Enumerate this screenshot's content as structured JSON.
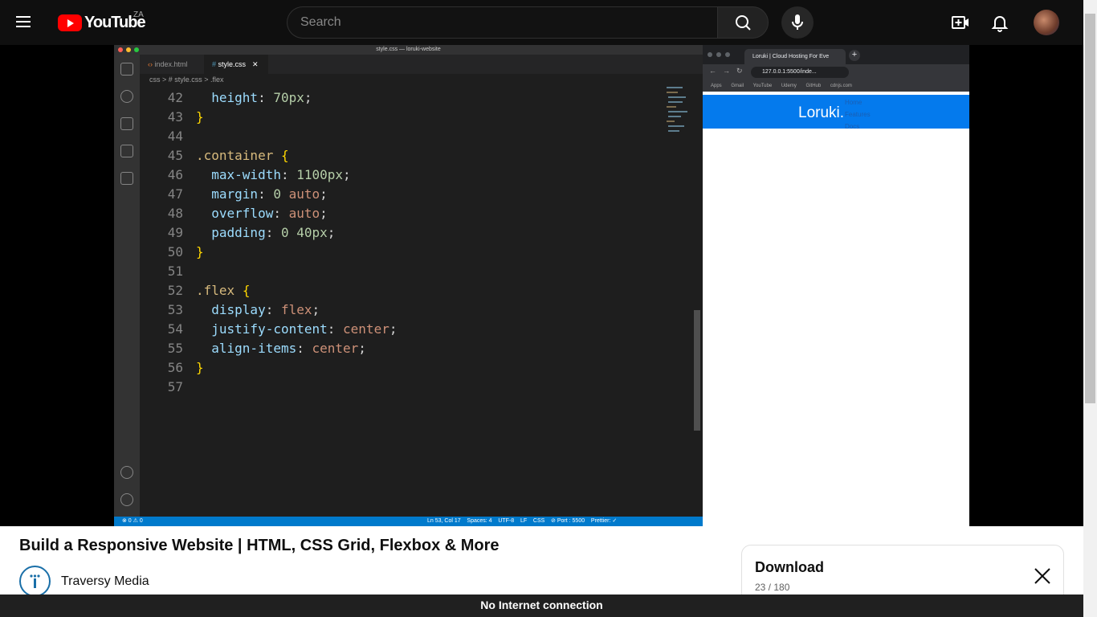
{
  "header": {
    "logo_text": "YouTube",
    "country": "ZA",
    "search_placeholder": "Search"
  },
  "vscode": {
    "window_title": "style.css — loruki-website",
    "tabs": [
      {
        "label": "index.html",
        "active": false
      },
      {
        "label": "style.css",
        "active": true
      }
    ],
    "breadcrumb": "css  >  # style.css  >  .flex",
    "code": [
      {
        "ln": "42",
        "parts": [
          [
            "prop",
            "  height"
          ],
          [
            "punc",
            ": "
          ],
          [
            "num",
            "70px"
          ],
          [
            "punc",
            ";"
          ]
        ]
      },
      {
        "ln": "43",
        "parts": [
          [
            "brace",
            "}"
          ]
        ]
      },
      {
        "ln": "44",
        "parts": []
      },
      {
        "ln": "45",
        "parts": [
          [
            "sel",
            ".container"
          ],
          [
            "punc",
            " "
          ],
          [
            "brace",
            "{"
          ]
        ]
      },
      {
        "ln": "46",
        "parts": [
          [
            "prop",
            "  max-width"
          ],
          [
            "punc",
            ": "
          ],
          [
            "num",
            "1100px"
          ],
          [
            "punc",
            ";"
          ]
        ]
      },
      {
        "ln": "47",
        "parts": [
          [
            "prop",
            "  margin"
          ],
          [
            "punc",
            ": "
          ],
          [
            "num",
            "0"
          ],
          [
            "punc",
            " "
          ],
          [
            "val",
            "auto"
          ],
          [
            "punc",
            ";"
          ]
        ]
      },
      {
        "ln": "48",
        "parts": [
          [
            "prop",
            "  overflow"
          ],
          [
            "punc",
            ": "
          ],
          [
            "val",
            "auto"
          ],
          [
            "punc",
            ";"
          ]
        ]
      },
      {
        "ln": "49",
        "parts": [
          [
            "prop",
            "  padding"
          ],
          [
            "punc",
            ": "
          ],
          [
            "num",
            "0"
          ],
          [
            "punc",
            " "
          ],
          [
            "num",
            "40px"
          ],
          [
            "punc",
            ";"
          ]
        ]
      },
      {
        "ln": "50",
        "parts": [
          [
            "brace",
            "}"
          ]
        ]
      },
      {
        "ln": "51",
        "parts": []
      },
      {
        "ln": "52",
        "parts": [
          [
            "sel",
            ".flex"
          ],
          [
            "punc",
            " "
          ],
          [
            "brace",
            "{"
          ]
        ]
      },
      {
        "ln": "53",
        "parts": [
          [
            "prop",
            "  display"
          ],
          [
            "punc",
            ": "
          ],
          [
            "val",
            "flex"
          ],
          [
            "punc",
            ";"
          ]
        ]
      },
      {
        "ln": "54",
        "parts": [
          [
            "prop",
            "  justify-content"
          ],
          [
            "punc",
            ": "
          ],
          [
            "val",
            "center"
          ],
          [
            "punc",
            ";"
          ]
        ]
      },
      {
        "ln": "55",
        "parts": [
          [
            "prop",
            "  align-items"
          ],
          [
            "punc",
            ": "
          ],
          [
            "val",
            "center"
          ],
          [
            "punc",
            ";"
          ]
        ]
      },
      {
        "ln": "56",
        "parts": [
          [
            "brace",
            "}"
          ]
        ]
      },
      {
        "ln": "57",
        "parts": []
      }
    ],
    "status_left": "⊗ 0 ⚠ 0",
    "status_right": "Ln 53, Col 17    Spaces: 4    UTF-8    LF    CSS    ⊘ Port : 5500    Prettier: ✓"
  },
  "browser": {
    "tab_title": "Loruki | Cloud Hosting For Eve",
    "url": "127.0.0.1:5500/inde...",
    "bookmarks": [
      "Apps",
      "Gmail",
      "YouTube",
      "Udemy",
      "GitHub",
      "cdnjs.com"
    ],
    "site_logo": "Loruki.",
    "site_nav": [
      "Home",
      "Features",
      "Docs"
    ]
  },
  "video": {
    "title": "Build a Responsive Website | HTML, CSS Grid, Flexbox & More",
    "channel": "Traversy Media"
  },
  "download": {
    "title": "Download",
    "count": "23 / 180"
  },
  "offline_message": "No Internet connection",
  "colors": {
    "accent": "#ff0000",
    "vscode_status": "#007acc",
    "site_nav": "#047aed"
  }
}
